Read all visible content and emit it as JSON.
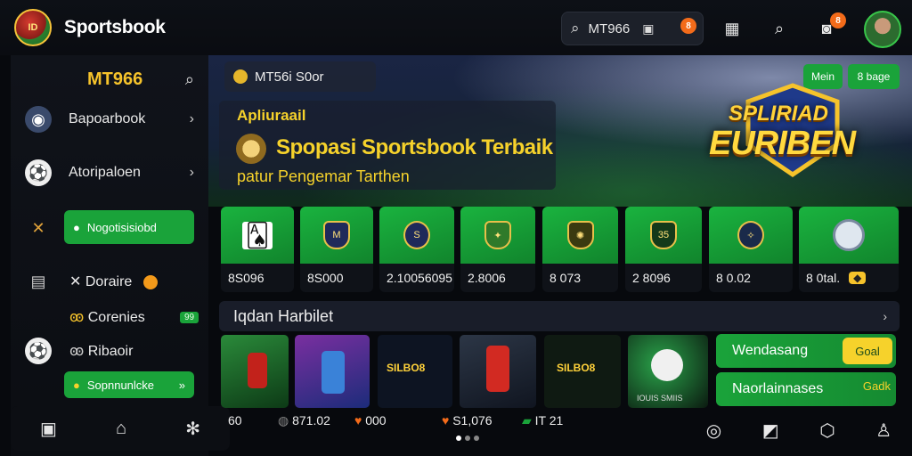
{
  "app": {
    "brand": "Sportsbook",
    "logo_text": "ID"
  },
  "topbar": {
    "search_text": "MT966",
    "cam_badge": "8",
    "gift_badge": "8"
  },
  "sidebar": {
    "header": "MT966",
    "items": [
      {
        "label": "Bapoarbook"
      },
      {
        "label": "Atoripaloen"
      },
      {
        "label": "Nogotisisiobd"
      },
      {
        "label": "Doraire"
      },
      {
        "label": "Corenies",
        "badge": "99"
      },
      {
        "label": "Ribaoir"
      },
      {
        "label": "Sopnnunlcke"
      }
    ]
  },
  "hero": {
    "tag": "MT56i S0or",
    "subtitle": "Apliuraail",
    "title": "Spopasi Sportsbook Terbaik",
    "tagline": "patur Pengemar Tarthen",
    "btn_main": "Mein",
    "btn_bage": "8 bage",
    "euro_1": "SPLIRIAD",
    "euro_2": "EURIBEN"
  },
  "tiles": [
    {
      "value": "8S096",
      "art": "cards"
    },
    {
      "value": "8S000",
      "art": "club"
    },
    {
      "value": "2.10056095",
      "art": "s-crest"
    },
    {
      "value": "2.8006",
      "art": "crest"
    },
    {
      "value": "8 073",
      "art": "crest"
    },
    {
      "value": "2 8096",
      "art": "35"
    },
    {
      "value": "8 0.02",
      "art": "crest"
    },
    {
      "value": "8 0tal.",
      "art": "coin"
    }
  ],
  "section": {
    "title": "Iqdan Harbilet"
  },
  "cards": [
    {
      "label": "60"
    },
    {
      "label": "871.02"
    },
    {
      "label": "000"
    },
    {
      "label": "S1,076"
    },
    {
      "label": "IT 21"
    },
    {
      "label": "IOUIS SMIIS"
    }
  ],
  "card_texts": {
    "c2": "SILBO8",
    "c4": "SILBO8"
  },
  "side_actions": [
    {
      "label": "Wendasang",
      "button": "Goal"
    },
    {
      "label": "Naorlainnases",
      "button": "Gadk"
    }
  ],
  "colors": {
    "accent_green": "#1aa33a",
    "accent_yellow": "#f6d22b",
    "orange": "#f36b1a",
    "bg": "#07090d"
  }
}
